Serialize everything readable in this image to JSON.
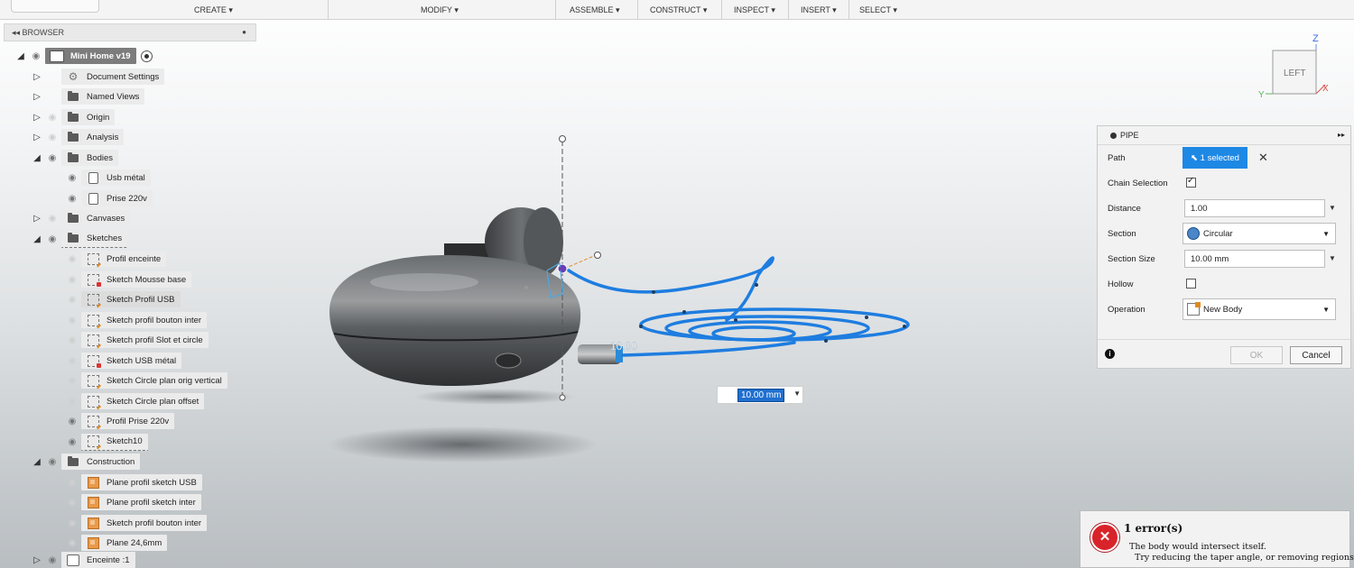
{
  "toolbar": {
    "create": "CREATE ▾",
    "modify": "MODIFY ▾",
    "assemble": "ASSEMBLE ▾",
    "construct": "CONSTRUCT ▾",
    "inspect": "INSPECT ▾",
    "insert": "INSERT ▾",
    "select": "SELECT ▾"
  },
  "browser": {
    "title": "BROWSER",
    "root": "Mini Home v19",
    "items": {
      "document_settings": "Document Settings",
      "named_views": "Named Views",
      "origin": "Origin",
      "analysis": "Analysis",
      "bodies": "Bodies",
      "usb_metal": "Usb métal",
      "prise_220v": "Prise 220v",
      "canvases": "Canvases",
      "sketches": "Sketches",
      "profil_enceinte": "Profil enceinte",
      "sketch_mousse_base": "Sketch Mousse base",
      "sketch_profil_usb": "Sketch Profil USB",
      "sketch_profil_bouton_inter": "Sketch profil  bouton inter",
      "sketch_profil_slot": "Sketch profil Slot et circle",
      "sketch_usb_metal": "Sketch USB métal",
      "sketch_circle_vertical": "Sketch Circle plan orig vertical",
      "sketch_circle_offset": "Sketch Circle plan offset",
      "profil_prise": "Profil Prise 220v",
      "sketch10": "Sketch10",
      "construction": "Construction",
      "plane_usb": "Plane profil sketch USB",
      "plane_inter": "Plane profil sketch inter",
      "sketch_bouton_inter2": "Sketch profil  bouton inter",
      "plane_246": "Plane 24,6mm",
      "enceinte": "Enceinte  :1"
    }
  },
  "viewcube": {
    "face": "LEFT",
    "axis_z": "Z",
    "axis_y": "Y",
    "axis_x": "X"
  },
  "viewport": {
    "dim_label": "10.00",
    "dim_input": "10.00 mm"
  },
  "pipe": {
    "title": "PIPE",
    "path_label": "Path",
    "path_value": "1 selected",
    "chain_label": "Chain Selection",
    "chain_checked": true,
    "distance_label": "Distance",
    "distance_value": "1.00",
    "section_label": "Section",
    "section_value": "Circular",
    "section_size_label": "Section Size",
    "section_size_value": "10.00 mm",
    "hollow_label": "Hollow",
    "hollow_checked": false,
    "operation_label": "Operation",
    "operation_value": "New Body",
    "ok": "OK",
    "cancel": "Cancel"
  },
  "error": {
    "title": "1 error(s)",
    "line1": "The body would intersect itself.",
    "line2": "Try reducing the taper angle, or removing regions"
  },
  "colors": {
    "accent": "#1e88e5",
    "path_blue": "#1e7de0",
    "error_red": "#d9232a"
  }
}
